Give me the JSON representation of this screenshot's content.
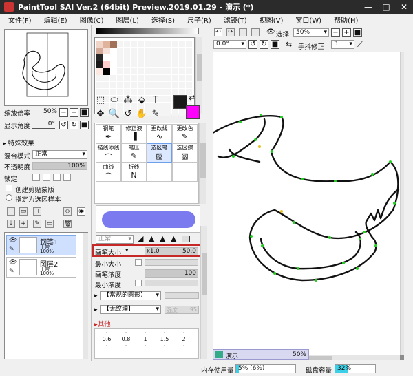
{
  "window": {
    "title": "PaintTool SAI Ver.2 (64bit) Preview.2019.01.29 - 演示 (*)",
    "controls": {
      "minimize": "—",
      "maximize": "□",
      "close": "✕"
    }
  },
  "menu": [
    "文件(F)",
    "编辑(E)",
    "图像(C)",
    "图层(L)",
    "选择(S)",
    "尺子(R)",
    "滤镜(T)",
    "视图(V)",
    "窗口(W)",
    "帮助(H)"
  ],
  "navigator": {
    "zoom_label": "缩放倍率",
    "zoom_value": "50%",
    "angle_label": "显示角度",
    "angle_value": "0°"
  },
  "effects": {
    "header": "特殊效果"
  },
  "layer_props": {
    "blend_label": "混合模式",
    "blend_value": "正常",
    "opacity_label": "不透明度",
    "opacity_value": "100%",
    "opacity_fraction": 1.0,
    "lock_label": "锁定",
    "clip_label": "创建剪贴蒙版",
    "select_src_label": "指定为选区样本"
  },
  "layers": [
    {
      "name": "钢笔1",
      "mode": "正常",
      "opacity": "100%",
      "selected": true
    },
    {
      "name": "图层2",
      "mode": "正常",
      "opacity": "100%",
      "selected": false
    }
  ],
  "swatch_colors": [
    "#f2d5c9",
    "#e0b49c",
    "#a07058",
    "#d4a998",
    "#f5e1da",
    "#262626",
    "#1a1a1a",
    "#ffcccc",
    "#fde9e1",
    "#000000"
  ],
  "colors": {
    "primary": "#1a1a1a",
    "secondary": "#ff00ff"
  },
  "tools_row1": [
    "⬚",
    "⬭",
    "⁂",
    "⬙",
    "T"
  ],
  "tools_row2": [
    "✥",
    "🔍",
    "↺",
    "✋",
    "✎"
  ],
  "brushes": [
    {
      "name": "钢笔",
      "icon": "✒"
    },
    {
      "name": "修正液",
      "icon": "▐"
    },
    {
      "name": "更改线",
      "icon": "∿"
    },
    {
      "name": "更改色",
      "icon": "✎"
    },
    {
      "name": "描线添线",
      "icon": "⌒"
    },
    {
      "name": "笔压",
      "icon": "✎"
    },
    {
      "name": "选区笔",
      "icon": "▨"
    },
    {
      "name": "选区擦",
      "icon": "▨"
    },
    {
      "name": "曲线",
      "icon": "⌒"
    },
    {
      "name": "折线",
      "icon": "N"
    },
    {
      "name": "",
      "icon": ""
    },
    {
      "name": "",
      "icon": ""
    }
  ],
  "brush_preview": {
    "color": "#7b7bef"
  },
  "brush_mode": "正常",
  "brush_size": {
    "label": "画笔大小",
    "multiplier": "x1.0",
    "value": "50.0"
  },
  "min_size": {
    "label": "最小大小"
  },
  "density": {
    "label": "画笔浓度",
    "value": "100",
    "fraction": 1.0
  },
  "min_density": {
    "label": "最小浓度"
  },
  "shape": {
    "value": "【常规的圆形】"
  },
  "texture": {
    "value": "【无纹理】",
    "strength_label": "强度",
    "strength_value": "95"
  },
  "other": {
    "header": "其他",
    "size_presets": [
      "0.6",
      "0.8",
      "1",
      "1.5",
      "2"
    ]
  },
  "canvas_toolbar": {
    "select_label": "选择",
    "zoom_value": "50%",
    "angle_value": "0.0°",
    "stabilizer_label": "手抖修正",
    "stabilizer_value": "3"
  },
  "documents": [
    {
      "name": "演示",
      "zoom": "50%"
    }
  ],
  "status": {
    "memory_label": "内存使用量",
    "memory_value": "5% (6%)",
    "memory_fraction": 0.05,
    "disk_label": "磁盘容量",
    "disk_value": "32%",
    "disk_fraction": 0.32
  }
}
